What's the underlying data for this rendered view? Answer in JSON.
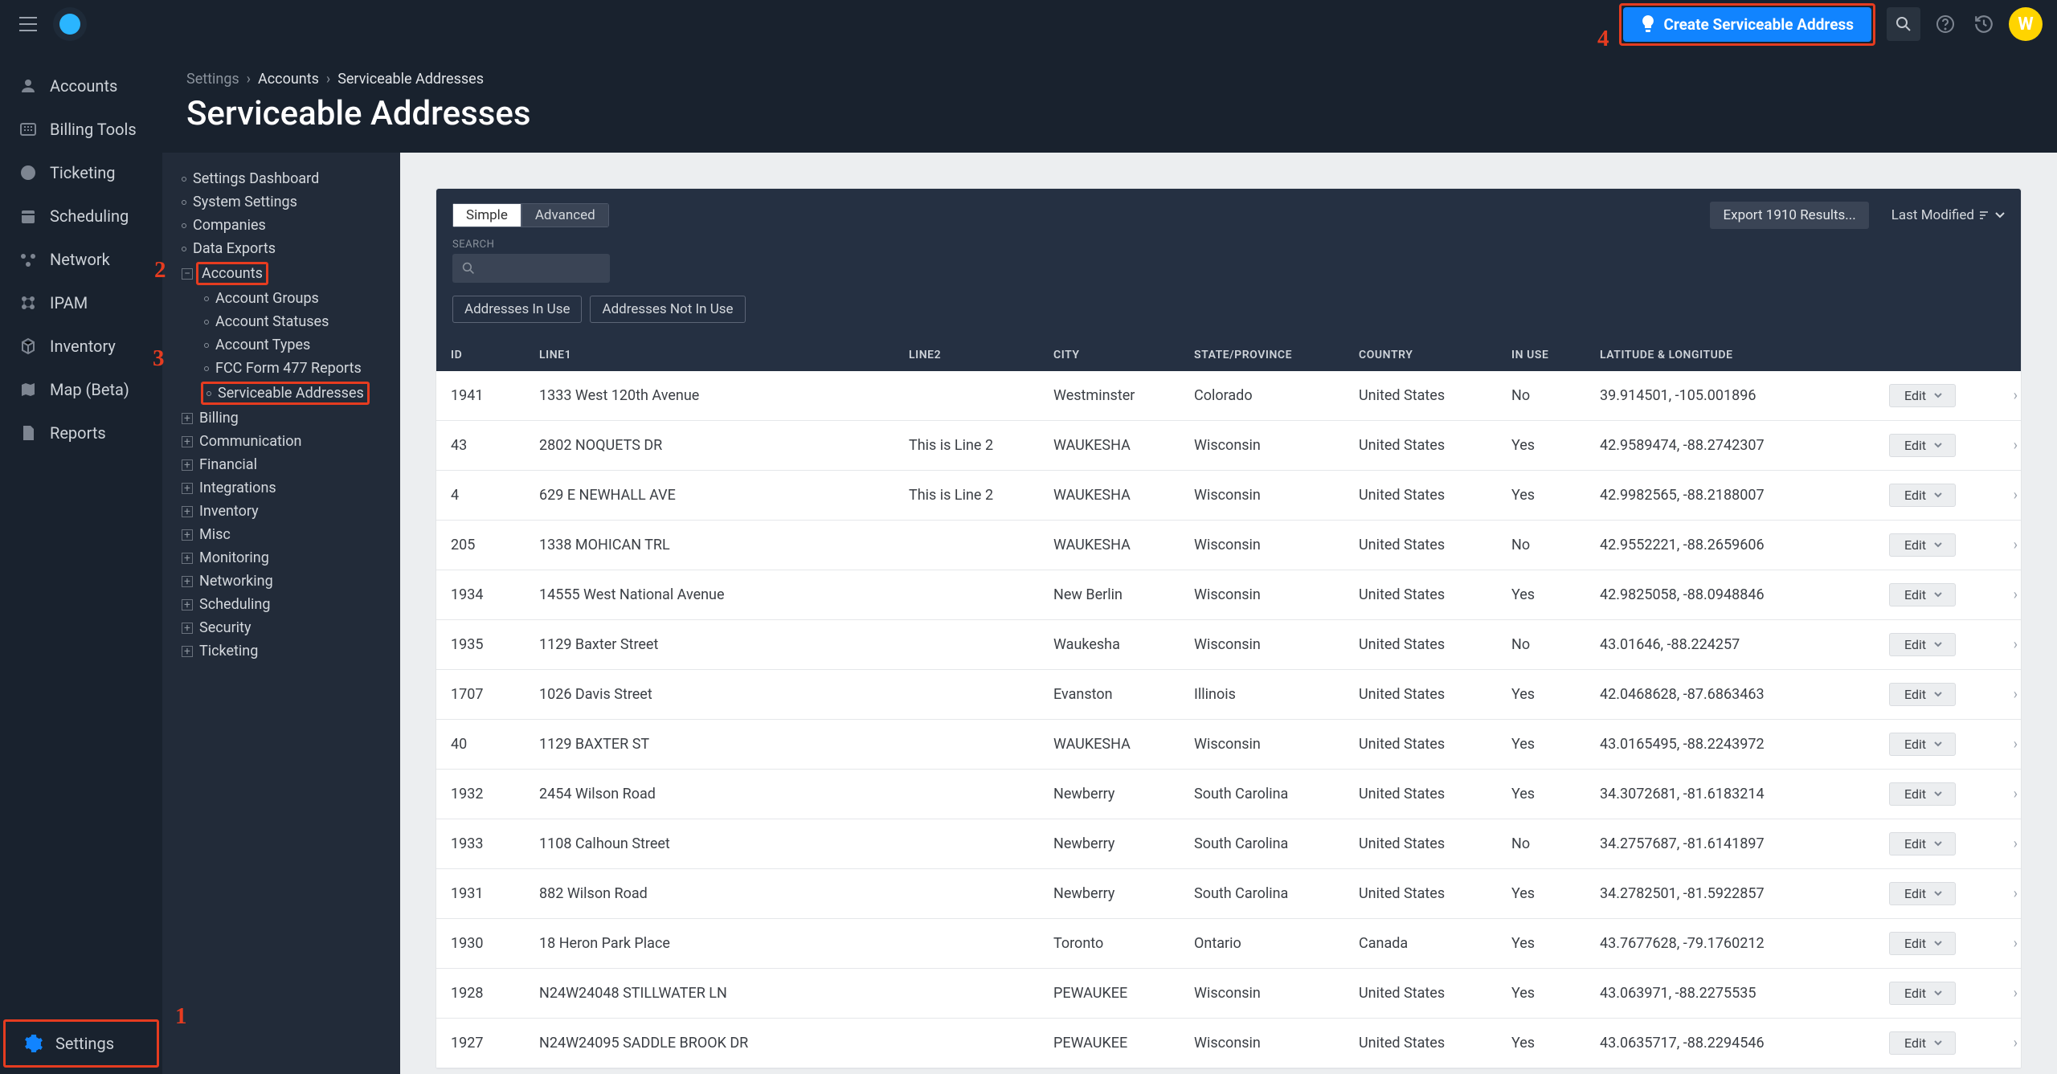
{
  "topbar": {
    "create_label": "Create Serviceable Address",
    "avatar_letter": "W"
  },
  "nav": {
    "items": [
      {
        "icon": "accounts",
        "label": "Accounts"
      },
      {
        "icon": "billing",
        "label": "Billing Tools"
      },
      {
        "icon": "ticket",
        "label": "Ticketing"
      },
      {
        "icon": "calendar",
        "label": "Scheduling"
      },
      {
        "icon": "network",
        "label": "Network"
      },
      {
        "icon": "ipam",
        "label": "IPAM"
      },
      {
        "icon": "inventory",
        "label": "Inventory"
      },
      {
        "icon": "map",
        "label": "Map (Beta)"
      },
      {
        "icon": "reports",
        "label": "Reports"
      }
    ],
    "settings_label": "Settings"
  },
  "breadcrumb": {
    "root": "Settings",
    "mid": "Accounts",
    "current": "Serviceable Addresses",
    "sep": "›"
  },
  "page_title": "Serviceable Addresses",
  "subnav": {
    "top": [
      "Settings Dashboard",
      "System Settings",
      "Companies",
      "Data Exports"
    ],
    "accounts_label": "Accounts",
    "account_children": [
      "Account Groups",
      "Account Statuses",
      "Account Types",
      "FCC Form 477 Reports",
      "Serviceable Addresses"
    ],
    "rest": [
      "Billing",
      "Communication",
      "Financial",
      "Integrations",
      "Inventory",
      "Misc",
      "Monitoring",
      "Networking",
      "Scheduling",
      "Security",
      "Ticketing"
    ]
  },
  "panel": {
    "tab_simple": "Simple",
    "tab_advanced": "Advanced",
    "export_label": "Export 1910 Results...",
    "sort_label": "Last Modified",
    "search_label": "SEARCH",
    "filter1": "Addresses In Use",
    "filter2": "Addresses Not In Use",
    "edit_label": "Edit"
  },
  "columns": [
    "ID",
    "LINE1",
    "LINE2",
    "CITY",
    "STATE/PROVINCE",
    "COUNTRY",
    "IN USE",
    "LATITUDE & LONGITUDE"
  ],
  "rows": [
    {
      "id": "1941",
      "line1": "1333 West 120th Avenue",
      "line2": "",
      "city": "Westminster",
      "state": "Colorado",
      "country": "United States",
      "inuse": "No",
      "latlon": "39.914501, -105.001896"
    },
    {
      "id": "43",
      "line1": "2802 NOQUETS DR",
      "line2": "This is Line 2",
      "city": "WAUKESHA",
      "state": "Wisconsin",
      "country": "United States",
      "inuse": "Yes",
      "latlon": "42.9589474, -88.2742307"
    },
    {
      "id": "4",
      "line1": "629 E NEWHALL AVE",
      "line2": "This is Line 2",
      "city": "WAUKESHA",
      "state": "Wisconsin",
      "country": "United States",
      "inuse": "Yes",
      "latlon": "42.9982565, -88.2188007"
    },
    {
      "id": "205",
      "line1": "1338 MOHICAN TRL",
      "line2": "",
      "city": "WAUKESHA",
      "state": "Wisconsin",
      "country": "United States",
      "inuse": "No",
      "latlon": "42.9552221, -88.2659606"
    },
    {
      "id": "1934",
      "line1": "14555 West National Avenue",
      "line2": "",
      "city": "New Berlin",
      "state": "Wisconsin",
      "country": "United States",
      "inuse": "Yes",
      "latlon": "42.9825058, -88.0948846"
    },
    {
      "id": "1935",
      "line1": "1129 Baxter Street",
      "line2": "",
      "city": "Waukesha",
      "state": "Wisconsin",
      "country": "United States",
      "inuse": "No",
      "latlon": "43.01646, -88.224257"
    },
    {
      "id": "1707",
      "line1": "1026 Davis Street",
      "line2": "",
      "city": "Evanston",
      "state": "Illinois",
      "country": "United States",
      "inuse": "Yes",
      "latlon": "42.0468628, -87.6863463"
    },
    {
      "id": "40",
      "line1": "1129 BAXTER ST",
      "line2": "",
      "city": "WAUKESHA",
      "state": "Wisconsin",
      "country": "United States",
      "inuse": "Yes",
      "latlon": "43.0165495, -88.2243972"
    },
    {
      "id": "1932",
      "line1": "2454 Wilson Road",
      "line2": "",
      "city": "Newberry",
      "state": "South Carolina",
      "country": "United States",
      "inuse": "Yes",
      "latlon": "34.3072681, -81.6183214"
    },
    {
      "id": "1933",
      "line1": "1108 Calhoun Street",
      "line2": "",
      "city": "Newberry",
      "state": "South Carolina",
      "country": "United States",
      "inuse": "No",
      "latlon": "34.2757687, -81.6141897"
    },
    {
      "id": "1931",
      "line1": "882 Wilson Road",
      "line2": "",
      "city": "Newberry",
      "state": "South Carolina",
      "country": "United States",
      "inuse": "Yes",
      "latlon": "34.2782501, -81.5922857"
    },
    {
      "id": "1930",
      "line1": "18 Heron Park Place",
      "line2": "",
      "city": "Toronto",
      "state": "Ontario",
      "country": "Canada",
      "inuse": "Yes",
      "latlon": "43.7677628, -79.1760212"
    },
    {
      "id": "1928",
      "line1": "N24W24048 STILLWATER LN",
      "line2": "",
      "city": "PEWAUKEE",
      "state": "Wisconsin",
      "country": "United States",
      "inuse": "Yes",
      "latlon": "43.063971, -88.2275535"
    },
    {
      "id": "1927",
      "line1": "N24W24095 SADDLE BROOK DR",
      "line2": "",
      "city": "PEWAUKEE",
      "state": "Wisconsin",
      "country": "United States",
      "inuse": "Yes",
      "latlon": "43.0635717, -88.2294546"
    }
  ],
  "annotations": {
    "n1": "1",
    "n2": "2",
    "n3": "3",
    "n4": "4"
  }
}
